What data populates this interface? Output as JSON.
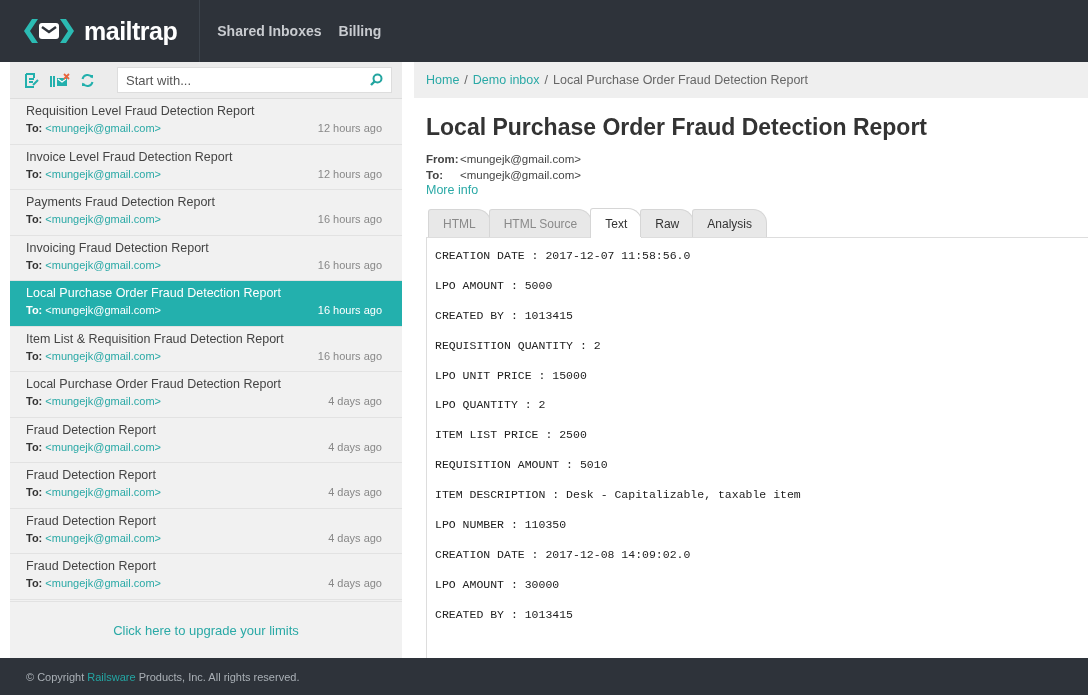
{
  "header": {
    "logo": "mailtrap",
    "nav": [
      "Shared Inboxes",
      "Billing"
    ]
  },
  "search": {
    "placeholder": "Start with..."
  },
  "messages": [
    {
      "subject": "Requisition Level Fraud Detection Report",
      "to_label": "To:",
      "to": "<mungejk@gmail.com>",
      "time": "12 hours ago",
      "selected": false
    },
    {
      "subject": "Invoice Level Fraud Detection Report",
      "to_label": "To:",
      "to": "<mungejk@gmail.com>",
      "time": "12 hours ago",
      "selected": false
    },
    {
      "subject": "Payments Fraud Detection Report",
      "to_label": "To:",
      "to": "<mungejk@gmail.com>",
      "time": "16 hours ago",
      "selected": false
    },
    {
      "subject": "Invoicing Fraud Detection Report",
      "to_label": "To:",
      "to": "<mungejk@gmail.com>",
      "time": "16 hours ago",
      "selected": false
    },
    {
      "subject": "Local Purchase Order Fraud Detection Report",
      "to_label": "To:",
      "to": "<mungejk@gmail.com>",
      "time": "16 hours ago",
      "selected": true
    },
    {
      "subject": "Item List & Requisition Fraud Detection Report",
      "to_label": "To:",
      "to": "<mungejk@gmail.com>",
      "time": "16 hours ago",
      "selected": false
    },
    {
      "subject": "Local Purchase Order Fraud Detection Report",
      "to_label": "To:",
      "to": "<mungejk@gmail.com>",
      "time": "4 days ago",
      "selected": false
    },
    {
      "subject": "Fraud Detection Report",
      "to_label": "To:",
      "to": "<mungejk@gmail.com>",
      "time": "4 days ago",
      "selected": false
    },
    {
      "subject": "Fraud Detection Report",
      "to_label": "To:",
      "to": "<mungejk@gmail.com>",
      "time": "4 days ago",
      "selected": false
    },
    {
      "subject": "Fraud Detection Report",
      "to_label": "To:",
      "to": "<mungejk@gmail.com>",
      "time": "4 days ago",
      "selected": false
    },
    {
      "subject": "Fraud Detection Report",
      "to_label": "To:",
      "to": "<mungejk@gmail.com>",
      "time": "4 days ago",
      "selected": false
    }
  ],
  "upgrade_link": "Click here to upgrade your limits",
  "breadcrumb": {
    "links": [
      "Home",
      "Demo inbox"
    ],
    "separator": "/",
    "current": "Local Purchase Order Fraud Detection Report"
  },
  "message": {
    "title": "Local Purchase Order Fraud Detection Report",
    "headers": [
      {
        "label": "From:",
        "value": "<mungejk@gmail.com>"
      },
      {
        "label": "To:",
        "value": "<mungejk@gmail.com>"
      }
    ],
    "more_info": "More info",
    "tabs": [
      {
        "label": "HTML",
        "selected": false,
        "disabled": true
      },
      {
        "label": "HTML Source",
        "selected": false,
        "disabled": true
      },
      {
        "label": "Text",
        "selected": true,
        "disabled": false
      },
      {
        "label": "Raw",
        "selected": false,
        "disabled": false
      },
      {
        "label": "Analysis",
        "selected": false,
        "disabled": false
      }
    ],
    "body": [
      "CREATION DATE : 2017-12-07 11:58:56.0",
      "LPO AMOUNT : 5000",
      "CREATED BY : 1013415",
      "REQUISITION QUANTITY : 2",
      "LPO UNIT PRICE : 15000",
      "LPO QUANTITY : 2",
      "ITEM LIST PRICE : 2500",
      "REQUISITION AMOUNT : 5010",
      "ITEM DESCRIPTION : Desk - Capitalizable, taxable item",
      "LPO NUMBER : 110350",
      "CREATION DATE : 2017-12-08 14:09:02.0",
      "LPO AMOUNT : 30000",
      "CREATED BY : 1013415"
    ]
  },
  "footer": {
    "before": "© Copyright ",
    "link": "Railsware",
    "after": " Products, Inc. All rights reserved."
  }
}
